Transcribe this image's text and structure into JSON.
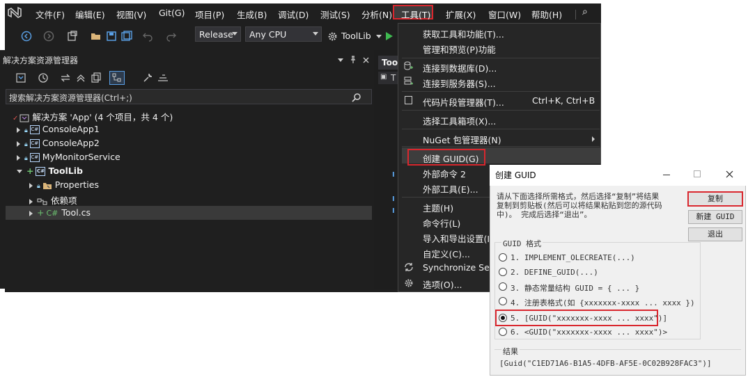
{
  "menubar": {
    "items": [
      "文件(F)",
      "编辑(E)",
      "视图(V)",
      "Git(G)",
      "项目(P)",
      "生成(B)",
      "调试(D)",
      "测试(S)",
      "分析(N)",
      "工具(T)",
      "扩展(X)",
      "窗口(W)",
      "帮助(H)"
    ],
    "search_glyph": "⌕"
  },
  "toolbar": {
    "config": "Release",
    "platform": "Any CPU",
    "startup": "ToolLib"
  },
  "solution_explorer": {
    "title": "解决方案资源管理器",
    "search_placeholder": "搜索解决方案资源管理器(Ctrl+;)",
    "solution": "解决方案 'App' (4 个项目，共 4 个)",
    "projects": [
      "ConsoleApp1",
      "ConsoleApp2",
      "MyMonitorService",
      "ToolLib"
    ],
    "toollib_children": [
      "Properties",
      "依赖项",
      "Tool.cs"
    ]
  },
  "editor": {
    "tab": "Too",
    "sub_tab": "T"
  },
  "tools_menu": {
    "items": [
      {
        "label": "获取工具和功能(T)...",
        "shortcut": ""
      },
      {
        "label": "管理和预览(P)功能",
        "shortcut": ""
      },
      {
        "label": "连接到数据库(D)...",
        "shortcut": ""
      },
      {
        "label": "连接到服务器(S)...",
        "shortcut": ""
      },
      {
        "label": "代码片段管理器(T)...",
        "shortcut": "Ctrl+K, Ctrl+B"
      },
      {
        "label": "选择工具箱项(X)...",
        "shortcut": ""
      },
      {
        "label": "NuGet 包管理器(N)",
        "shortcut": ""
      },
      {
        "label": "创建 GUID(G)",
        "shortcut": ""
      },
      {
        "label": "外部命令 2",
        "shortcut": ""
      },
      {
        "label": "外部工具(E)...",
        "shortcut": ""
      },
      {
        "label": "主题(H)",
        "shortcut": ""
      },
      {
        "label": "命令行(L)",
        "shortcut": ""
      },
      {
        "label": "导入和导出设置(I)",
        "shortcut": ""
      },
      {
        "label": "自定义(C)...",
        "shortcut": ""
      },
      {
        "label": "Synchronize Sett",
        "shortcut": ""
      },
      {
        "label": "选项(O)...",
        "shortcut": ""
      }
    ]
  },
  "guid_dialog": {
    "title": "创建 GUID",
    "instructions": [
      "请从下面选择所需格式，然后选择“复制”将结果",
      "复制到剪贴板(然后可以将结果粘贴到您的源代码",
      "中)。  完成后选择“退出”。"
    ],
    "buttons": {
      "copy": "复制",
      "new": "新建 GUID",
      "exit": "退出"
    },
    "group_label": "GUID 格式",
    "options": [
      "1.  IMPLEMENT_OLECREATE(...)",
      "2.  DEFINE_GUID(...)",
      "3.  静态常量结构 GUID = { ... }",
      "4.  注册表格式(如 {xxxxxxx-xxxx ... xxxx })",
      "5.  [GUID(\"xxxxxxx-xxxx ... xxxx\")]",
      "6.  <GUID(\"xxxxxxx-xxxx ... xxxx\")>"
    ],
    "selected_option": 5,
    "result_label": "结果",
    "result": "[Guid(\"C1ED71A6-B1A5-4DFB-AF5E-0C02B928FAC3\")]"
  }
}
